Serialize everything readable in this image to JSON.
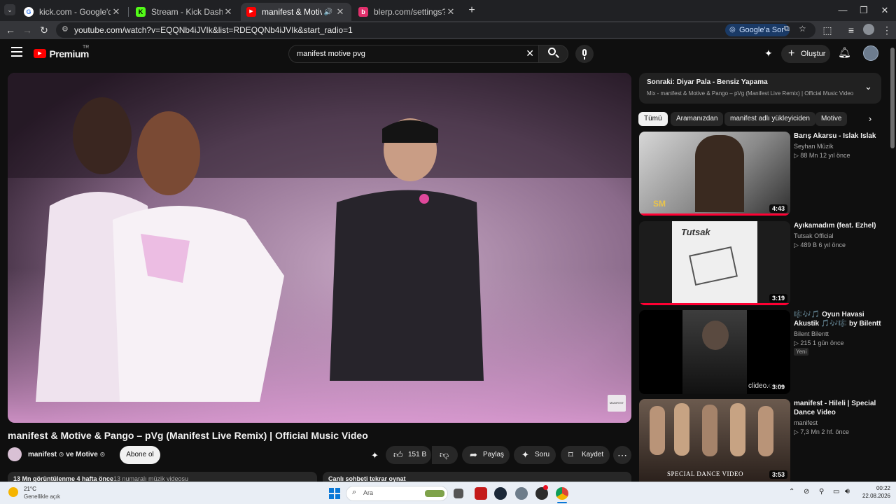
{
  "browser": {
    "tabs": [
      {
        "title": "kick.com - Google'da Ara",
        "color": "#4285f4"
      },
      {
        "title": "Stream - Kick Dashboard",
        "color": "#53fc18"
      },
      {
        "title": "manifest & Motive & Pango",
        "color": "#ff0000"
      },
      {
        "title": "blerp.com/settings?settingsTyp",
        "color": "#e1306c"
      }
    ],
    "new_tab": "+",
    "url": "youtube.com/watch?v=EQQNb4iJVIk&list=RDEQQNb4iJVIk&start_radio=1",
    "google_search_label": "Google'a Sor"
  },
  "youtube": {
    "logo": "Premium",
    "region": "TR",
    "search_value": "manifest motive pvg",
    "create_label": "Oluştur",
    "video": {
      "title": "manifest & Motive & Pango – pVg (Manifest Live Remix) | Official Music Video",
      "channel": "manifest",
      "channel_and": "ve Motive",
      "subscribe": "Abone ol",
      "likes": "151 B",
      "share": "Paylaş",
      "ask": "Soru",
      "save": "Kaydet",
      "watermark": "MANIFEST",
      "views_text": "13 Mn görüntülenme  4 hafta önce",
      "views_tag": "13 numaralı müzik videosu",
      "chat_replay": "Canlı sohbeti tekrar oynat"
    },
    "up_next": {
      "title": "Sonraki: Diyar Pala - Bensiz Yapama",
      "subtitle": "Mix - manifest & Motive & Pango – pVg (Manifest Live Remix) | Official Music Video"
    },
    "chips": [
      "Tümü",
      "Aramanızdan",
      "manifest adlı yükleyiciden",
      "Motive"
    ],
    "related": [
      {
        "title": "Barış Akarsu - Islak Islak",
        "channel": "Seyhan Müzik",
        "meta": "▷ 88 Mn  12 yıl önce",
        "duration": "4:43",
        "thumb_text": "SM",
        "thumb_colors": [
          "#cfcfcf",
          "#3a3a3a"
        ]
      },
      {
        "title": "Ayıkamadım (feat. Ezhel)",
        "channel": "Tutsak Official",
        "meta": "▷ 489 B  6 yıl önce",
        "duration": "3:19",
        "thumb_text": "Tutsak",
        "thumb_colors": [
          "#e8e8e8",
          "#4a4a4a"
        ]
      },
      {
        "title": "🎼🎶🎵 Oyun Havasi Akustik 🎵🎶🎼 by Bilentt",
        "channel": "Bilent Bilentt",
        "meta": "▷ 215  1 gün önce",
        "badge": "Yeni",
        "duration": "3:09",
        "thumb_text": "clideo.com",
        "thumb_colors": [
          "#000000",
          "#2a2a2a"
        ]
      },
      {
        "title": "manifest - Hileli | Special Dance Video",
        "channel": "manifest",
        "meta": "▷ 7,3 Mn  2 hf. önce",
        "duration": "3:53",
        "thumb_text": "SPECIAL DANCE VIDEO",
        "thumb_colors": [
          "#6b5a4e",
          "#2b211c"
        ]
      }
    ]
  },
  "taskbar": {
    "temp": "21°C",
    "weather": "Genellikle açık",
    "search_placeholder": "Ara",
    "time": "00:22",
    "date": "22.08.2026"
  }
}
